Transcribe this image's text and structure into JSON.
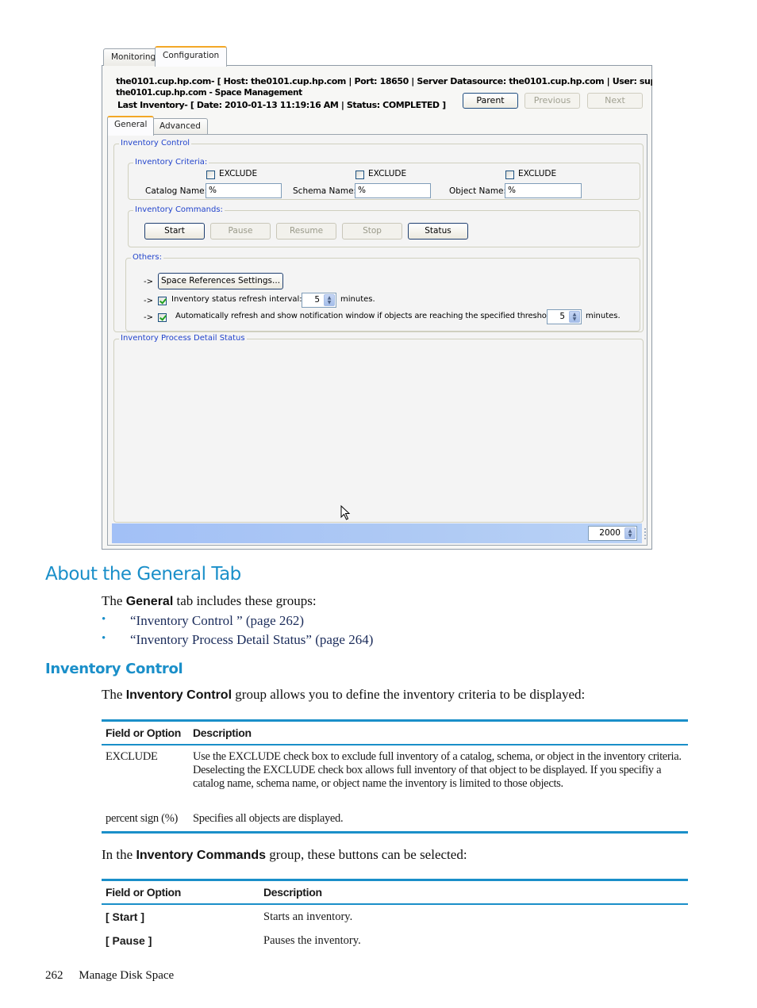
{
  "app": {
    "top_tabs": [
      {
        "label": "Monitoring",
        "active": false
      },
      {
        "label": "Configuration",
        "active": true
      }
    ],
    "connection": {
      "line1": "the0101.cup.hp.com- [ Host: the0101.cup.hp.com | Port: 18650 | Server Datasource: the0101.cup.hp.com | User: super.se",
      "line2": "the0101.cup.hp.com - Space Management",
      "line3": "Last Inventory- [ Date: 2010-01-13 11:19:16 AM | Status: COMPLETED ]"
    },
    "nav_buttons": {
      "parent": "Parent",
      "previous": "Previous",
      "next": "Next"
    },
    "sub_tabs": [
      {
        "label": "General",
        "active": true
      },
      {
        "label": "Advanced",
        "active": false
      }
    ],
    "inventory_control": {
      "title": "Inventory Control",
      "criteria": {
        "title": "Inventory Criteria:",
        "exclude_label": "EXCLUDE",
        "catalog": {
          "label": "Catalog Name:",
          "value": "%",
          "exclude_checked": false
        },
        "schema": {
          "label": "Schema Name:",
          "value": "%",
          "exclude_checked": false
        },
        "object": {
          "label": "Object Name:",
          "value": "%",
          "exclude_checked": false
        }
      },
      "commands": {
        "title": "Inventory Commands:",
        "buttons": [
          {
            "label": "Start",
            "enabled": true
          },
          {
            "label": "Pause",
            "enabled": false
          },
          {
            "label": "Resume",
            "enabled": false
          },
          {
            "label": "Stop",
            "enabled": false
          },
          {
            "label": "Status",
            "enabled": true
          }
        ]
      },
      "others": {
        "title": "Others:",
        "arrow": "->",
        "space_ref_button": "Space References Settings...",
        "refresh_interval": {
          "label": "Inventory status refresh interval:",
          "checked": true,
          "value": "5",
          "unit": "minutes."
        },
        "auto_refresh": {
          "label": "Automatically refresh and show notification window if objects are reaching the specified threshold:",
          "checked": true,
          "value": "5",
          "unit": "minutes."
        }
      }
    },
    "detail_status": {
      "title": "Inventory Process Detail Status"
    },
    "statusbar": {
      "spinner_value": "2000"
    }
  },
  "doc": {
    "heading1": "About the General Tab",
    "intro": {
      "before": "The ",
      "bold": "General",
      "after": " tab includes these groups:"
    },
    "bullets": [
      "“Inventory Control ” (page 262)",
      "“Inventory Process Detail Status” (page 264)"
    ],
    "heading2": "Inventory Control",
    "ic_para": {
      "before": "The ",
      "bold": "Inventory Control",
      "after": " group allows you to define the inventory criteria to be displayed:"
    },
    "table1": {
      "headers": [
        "Field or Option",
        "Description"
      ],
      "rows": [
        [
          "EXCLUDE",
          "Use the EXCLUDE check box to exclude full inventory of a catalog, schema, or object in the inventory criteria. Deselecting the EXCLUDE check box allows full inventory of that object to be displayed. If you specifiy a catalog name, schema name, or object name the inventory is limited to those objects."
        ],
        [
          "percent sign (%)",
          "Specifies all objects are displayed."
        ]
      ]
    },
    "cmd_para": {
      "before": "In the ",
      "bold": "Inventory Commands",
      "after": " group, these buttons can be selected:"
    },
    "table2": {
      "headers": [
        "Field or Option",
        "Description"
      ],
      "rows": [
        [
          "[ Start ]",
          "Starts an inventory."
        ],
        [
          "[ Pause ]",
          "Pauses the inventory."
        ]
      ]
    },
    "footer": {
      "page_number": "262",
      "section": "Manage Disk Space"
    }
  }
}
